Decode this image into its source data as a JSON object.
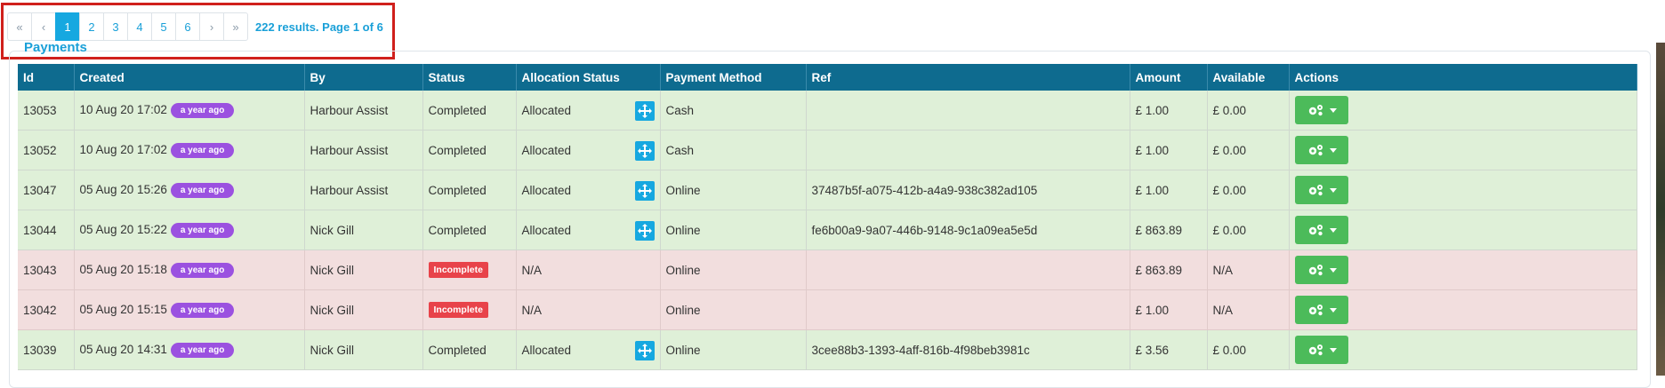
{
  "pagination": {
    "first": "«",
    "prev": "‹",
    "pages": [
      "1",
      "2",
      "3",
      "4",
      "5",
      "6"
    ],
    "active_page": "1",
    "next": "›",
    "last": "»",
    "info": "222 results. Page 1 of 6"
  },
  "panel_title": "Payments",
  "table": {
    "columns": [
      "Id",
      "Created",
      "By",
      "Status",
      "Allocation Status",
      "Payment Method",
      "Ref",
      "Amount",
      "Available",
      "Actions"
    ],
    "rows": [
      {
        "id": "13053",
        "created": "10 Aug 20 17:02",
        "age": "a year ago",
        "by": "Harbour Assist",
        "status": "Completed",
        "allocation": "Allocated",
        "method": "Cash",
        "ref": "",
        "amount": "£ 1.00",
        "available": "£ 0.00",
        "state": "ok"
      },
      {
        "id": "13052",
        "created": "10 Aug 20 17:02",
        "age": "a year ago",
        "by": "Harbour Assist",
        "status": "Completed",
        "allocation": "Allocated",
        "method": "Cash",
        "ref": "",
        "amount": "£ 1.00",
        "available": "£ 0.00",
        "state": "ok"
      },
      {
        "id": "13047",
        "created": "05 Aug 20 15:26",
        "age": "a year ago",
        "by": "Harbour Assist",
        "status": "Completed",
        "allocation": "Allocated",
        "method": "Online",
        "ref": "37487b5f-a075-412b-a4a9-938c382ad105",
        "amount": "£ 1.00",
        "available": "£ 0.00",
        "state": "ok"
      },
      {
        "id": "13044",
        "created": "05 Aug 20 15:22",
        "age": "a year ago",
        "by": "Nick Gill",
        "status": "Completed",
        "allocation": "Allocated",
        "method": "Online",
        "ref": "fe6b00a9-9a07-446b-9148-9c1a09ea5e5d",
        "amount": "£ 863.89",
        "available": "£ 0.00",
        "state": "ok"
      },
      {
        "id": "13043",
        "created": "05 Aug 20 15:18",
        "age": "a year ago",
        "by": "Nick Gill",
        "status": "Incomplete",
        "allocation": "N/A",
        "method": "Online",
        "ref": "",
        "amount": "£ 863.89",
        "available": "N/A",
        "state": "bad"
      },
      {
        "id": "13042",
        "created": "05 Aug 20 15:15",
        "age": "a year ago",
        "by": "Nick Gill",
        "status": "Incomplete",
        "allocation": "N/A",
        "method": "Online",
        "ref": "",
        "amount": "£ 1.00",
        "available": "N/A",
        "state": "bad"
      },
      {
        "id": "13039",
        "created": "05 Aug 20 14:31",
        "age": "a year ago",
        "by": "Nick Gill",
        "status": "Completed",
        "allocation": "Allocated",
        "method": "Online",
        "ref": "3cee88b3-1393-4aff-816b-4f98beb3981c",
        "amount": "£ 3.56",
        "available": "£ 0.00",
        "state": "ok"
      }
    ]
  },
  "icons": {
    "allocate": "move-arrows-icon",
    "actions": "gears-icon",
    "dropdown": "caret-down-icon"
  },
  "colors": {
    "header_bg": "#0e6b8f",
    "accent": "#16a8e0",
    "completed_row": "#dff0d8",
    "incomplete_row": "#f2dede",
    "age_badge": "#9b51e0",
    "incomplete_badge": "#e8434a",
    "action_button": "#4cbb5a",
    "highlight": "#d0201c"
  }
}
